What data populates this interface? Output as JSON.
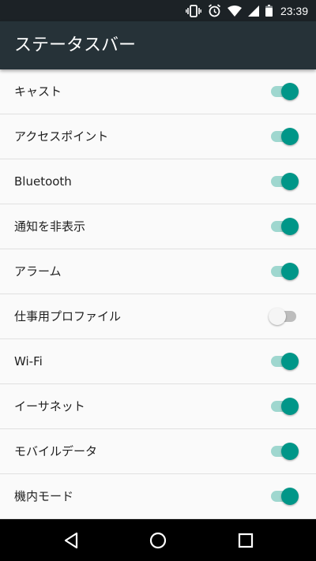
{
  "status_bar": {
    "time": "23:39",
    "icons": [
      "vibrate-icon",
      "alarm-icon",
      "wifi-icon",
      "cell-signal-icon",
      "battery-icon"
    ]
  },
  "app_bar": {
    "title": "ステータスバー"
  },
  "settings": {
    "items": [
      {
        "label": "キャスト",
        "enabled": true
      },
      {
        "label": "アクセスポイント",
        "enabled": true
      },
      {
        "label": "Bluetooth",
        "enabled": true
      },
      {
        "label": "通知を非表示",
        "enabled": true
      },
      {
        "label": "アラーム",
        "enabled": true
      },
      {
        "label": "仕事用プロファイル",
        "enabled": false
      },
      {
        "label": "Wi-Fi",
        "enabled": true
      },
      {
        "label": "イーサネット",
        "enabled": true
      },
      {
        "label": "モバイルデータ",
        "enabled": true
      },
      {
        "label": "機内モード",
        "enabled": true
      }
    ]
  },
  "nav_bar": {
    "buttons": [
      "back-icon",
      "home-icon",
      "recents-icon"
    ]
  },
  "colors": {
    "status_bar": "#1c2226",
    "app_bar": "#263238",
    "accent": "#009688",
    "accent_track": "#9fd7cf",
    "background": "#fafafa"
  }
}
